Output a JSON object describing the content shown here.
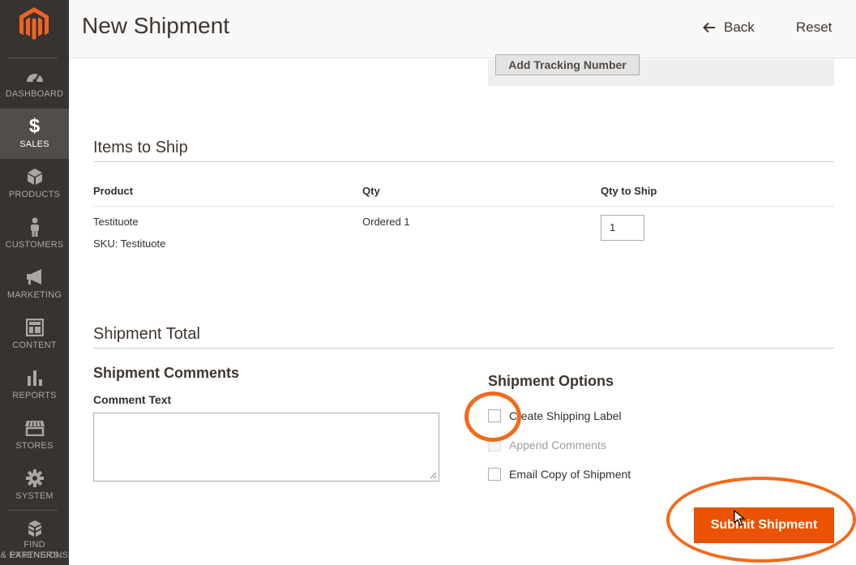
{
  "sidebar": {
    "items": [
      {
        "label": "DASHBOARD",
        "icon": "dashboard-icon"
      },
      {
        "label": "SALES",
        "icon": "dollar-icon",
        "active": true
      },
      {
        "label": "PRODUCTS",
        "icon": "cube-icon"
      },
      {
        "label": "CUSTOMERS",
        "icon": "person-icon"
      },
      {
        "label": "MARKETING",
        "icon": "megaphone-icon"
      },
      {
        "label": "CONTENT",
        "icon": "layout-icon"
      },
      {
        "label": "REPORTS",
        "icon": "bar-chart-icon"
      },
      {
        "label": "STORES",
        "icon": "storefront-icon"
      },
      {
        "label": "SYSTEM",
        "icon": "gear-icon"
      }
    ],
    "partners_line1": "FIND PARTNERS",
    "partners_line2": "& EXTENSIONS"
  },
  "header": {
    "title": "New Shipment",
    "back_label": "Back",
    "reset_label": "Reset"
  },
  "tracking": {
    "add_label": "Add Tracking Number"
  },
  "items": {
    "title": "Items to Ship",
    "columns": [
      "Product",
      "Qty",
      "Qty to Ship"
    ],
    "rows": [
      {
        "product": "Testituote",
        "sku": "SKU: Testituote",
        "qty": "Ordered 1",
        "qty_to_ship": "1"
      }
    ]
  },
  "totals": {
    "title": "Shipment Total",
    "comments_title": "Shipment Comments",
    "comment_label": "Comment Text",
    "comment_value": "",
    "options_title": "Shipment Options",
    "options": [
      {
        "label": "Create Shipping Label",
        "checked": false,
        "disabled": false
      },
      {
        "label": "Append Comments",
        "checked": false,
        "disabled": true
      },
      {
        "label": "Email Copy of Shipment",
        "checked": false,
        "disabled": false
      }
    ],
    "submit_label": "Submit Shipment"
  },
  "colors": {
    "sidebar_bg": "#373330",
    "accent": "#eb5202",
    "annotation": "#f26a1b"
  }
}
